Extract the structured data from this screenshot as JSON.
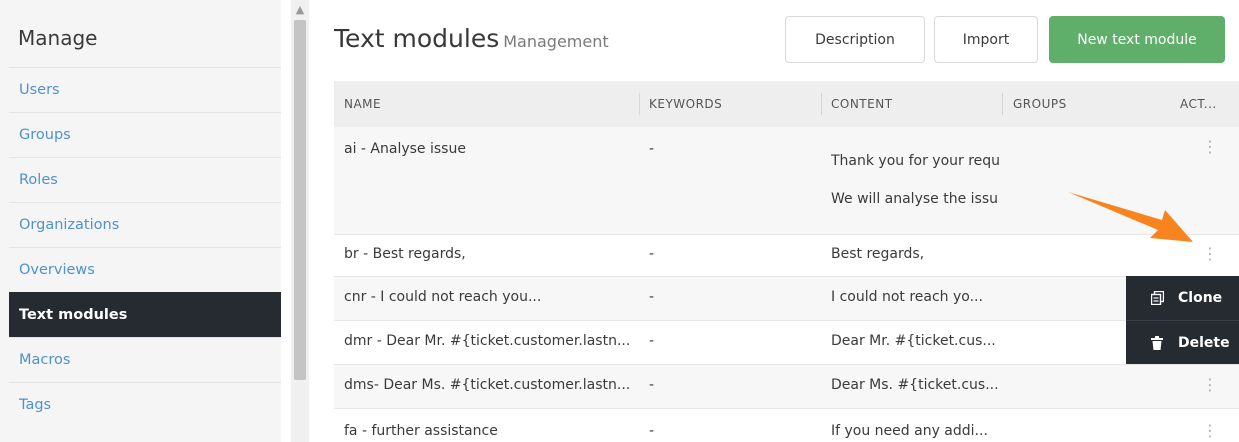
{
  "sidebar": {
    "title": "Manage",
    "items": [
      {
        "label": "Users"
      },
      {
        "label": "Groups"
      },
      {
        "label": "Roles"
      },
      {
        "label": "Organizations"
      },
      {
        "label": "Overviews"
      },
      {
        "label": "Text modules",
        "active": true
      },
      {
        "label": "Macros"
      },
      {
        "label": "Tags"
      }
    ]
  },
  "header": {
    "title": "Text modules",
    "subtitle": "Management",
    "buttons": {
      "description": "Description",
      "import": "Import",
      "new": "New text module"
    },
    "accent_color": "#5faf6a"
  },
  "table": {
    "columns": [
      "NAME",
      "KEYWORDS",
      "CONTENT",
      "GROUPS",
      "ACT..."
    ],
    "rows": [
      {
        "name": "ai - Analyse issue",
        "keywords": "-",
        "content": [
          "Thank you for your requ",
          "We will analyse the issu"
        ]
      },
      {
        "name": "br - Best regards,",
        "keywords": "-",
        "content": [
          "Best regards,"
        ]
      },
      {
        "name": "cnr - I could not reach you...",
        "keywords": "-",
        "content": [
          "I could not reach yo..."
        ]
      },
      {
        "name": "dmr - Dear Mr. #{ticket.customer.lastn...",
        "keywords": "-",
        "content": [
          "Dear Mr. #{ticket.cus..."
        ]
      },
      {
        "name": "dms- Dear Ms. #{ticket.customer.lastn...",
        "keywords": "-",
        "content": [
          "Dear Ms. #{ticket.cus..."
        ]
      },
      {
        "name": "fa - further assistance",
        "keywords": "-",
        "content": [
          "If you need any addi..."
        ]
      }
    ]
  },
  "action_menu": {
    "items": [
      {
        "label": "Clone",
        "icon": "clone-icon"
      },
      {
        "label": "Delete",
        "icon": "trash-icon"
      }
    ]
  },
  "annotation": {
    "icon": "orange-arrow-icon",
    "color": "#f7841f"
  }
}
